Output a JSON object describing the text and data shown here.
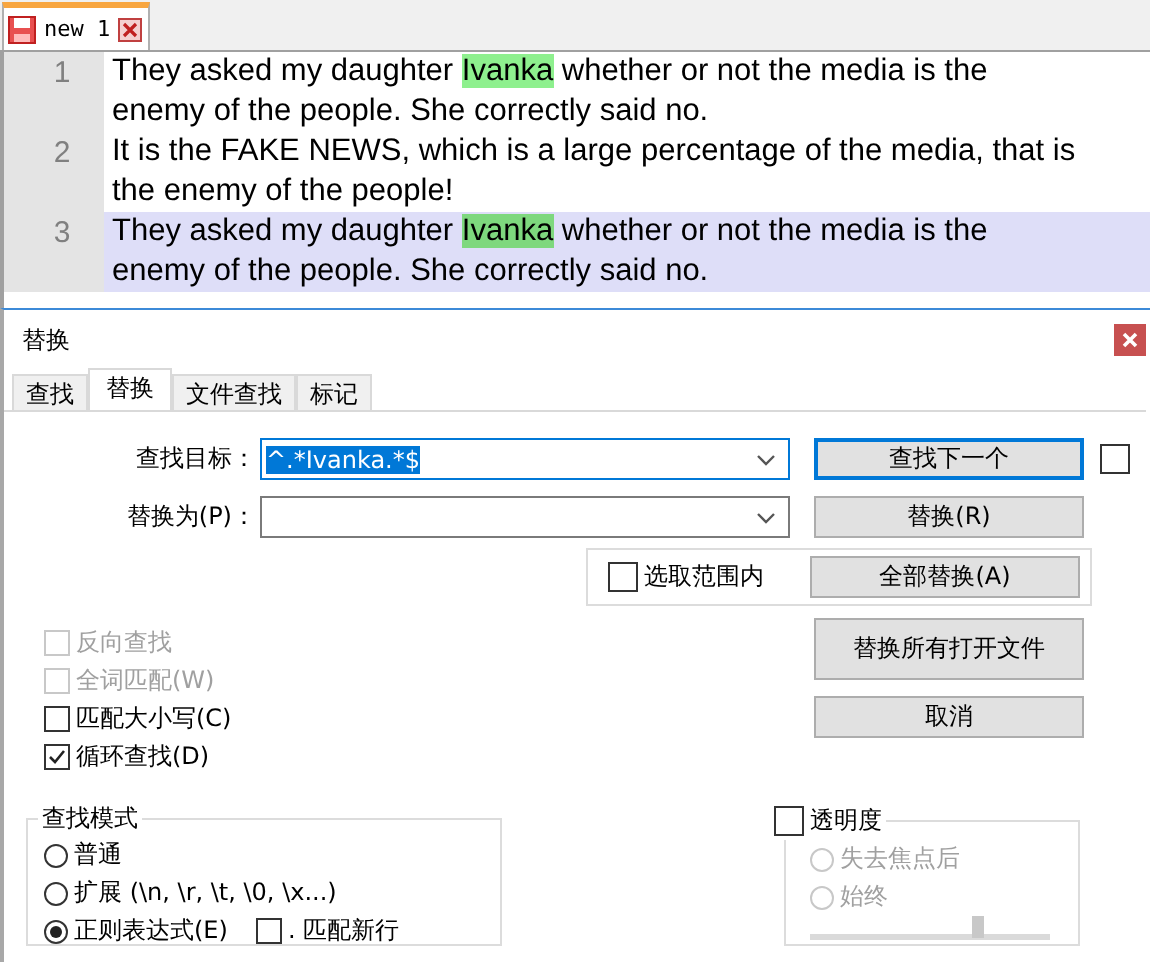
{
  "editor_tabs": [
    {
      "label": "new 1",
      "selected": true
    }
  ],
  "editor": {
    "lines": [
      {
        "number": "1",
        "current": false,
        "rows": [
          [
            {
              "text": "They asked my daughter ",
              "marked": false
            },
            {
              "text": "Ivanka",
              "marked": true
            },
            {
              "text": " whether or not the media is the",
              "marked": false
            }
          ],
          [
            {
              "text": "enemy of the people. She correctly said no.",
              "marked": false
            }
          ]
        ]
      },
      {
        "number": "2",
        "current": false,
        "rows": [
          [
            {
              "text": "It is the FAKE NEWS, which is a large percentage of the media, that is",
              "marked": false
            }
          ],
          [
            {
              "text": "the enemy of the people!",
              "marked": false
            }
          ]
        ]
      },
      {
        "number": "3",
        "current": true,
        "rows": [
          [
            {
              "text": "They asked my daughter ",
              "marked": false
            },
            {
              "text": "Ivanka",
              "marked": true
            },
            {
              "text": " whether or not the media is the",
              "marked": false
            }
          ],
          [
            {
              "text": "enemy of the people. She correctly said no.",
              "marked": false
            }
          ]
        ]
      }
    ]
  },
  "dialog": {
    "title": "替换",
    "tabs": [
      {
        "label": "查找",
        "selected": false
      },
      {
        "label": "替换",
        "selected": true
      },
      {
        "label": "文件查找",
        "selected": false
      },
      {
        "label": "标记",
        "selected": false
      }
    ],
    "find": {
      "label": "查找目标：",
      "value": "^.*Ivanka.*$",
      "focused": true
    },
    "replace": {
      "label": "替换为(P)：",
      "focused": false
    },
    "find_next_button": {
      "label": "查找下一个",
      "default": true
    },
    "two_buttons_toggle": {
      "checked": false
    },
    "in_selection": {
      "label": "选取范围内",
      "checked": false
    },
    "replace_button": {
      "label": "替换(R)",
      "default": false
    },
    "replace_all_button": {
      "label": "全部替换(A)",
      "default": false
    },
    "replace_all_open_button": {
      "label": "替换所有打开文件",
      "default": false
    },
    "cancel_button": {
      "label": "取消",
      "default": false
    },
    "options": [
      {
        "label": "反向查找",
        "checked": false,
        "disabled": true
      },
      {
        "label": "全词匹配(W)",
        "checked": false,
        "disabled": true
      },
      {
        "label": "匹配大小写(C)",
        "checked": false,
        "disabled": false
      },
      {
        "label": "循环查找(D)",
        "checked": true,
        "disabled": false
      }
    ],
    "search_mode": {
      "title": "查找模式",
      "modes": [
        {
          "label": "普通",
          "selected": false
        },
        {
          "label": "扩展 (\\n, \\r, \\t, \\0, \\x...)",
          "selected": false
        },
        {
          "label": "正则表达式(E)",
          "selected": true
        }
      ],
      "dot_newline": {
        "label": ". 匹配新行",
        "checked": false
      }
    },
    "transparency": {
      "label": "透明度",
      "checked": false,
      "modes": [
        {
          "label": "失去焦点后",
          "selected": false,
          "disabled": true
        },
        {
          "label": "始终",
          "selected": false,
          "disabled": true
        }
      ],
      "slider": {
        "level": 0.7,
        "disabled": true
      }
    }
  }
}
